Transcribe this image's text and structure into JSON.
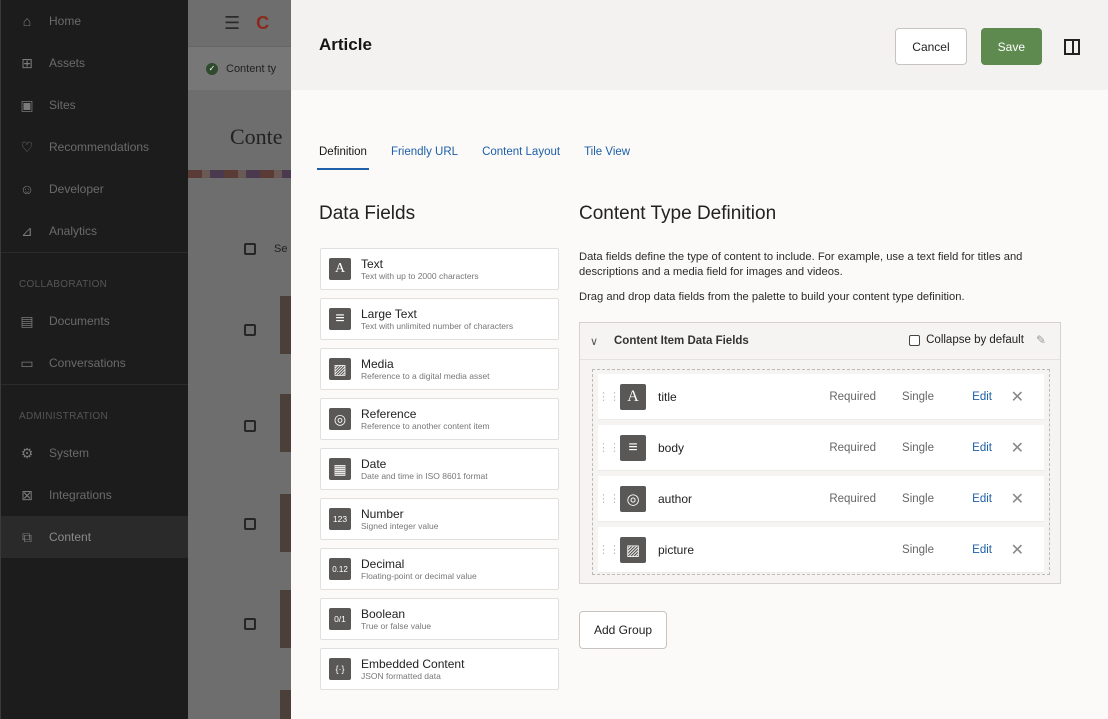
{
  "nav": {
    "items_top": [
      {
        "label": "Home",
        "icon": "home-icon"
      },
      {
        "label": "Assets",
        "icon": "assets-icon"
      },
      {
        "label": "Sites",
        "icon": "sites-icon"
      },
      {
        "label": "Recommendations",
        "icon": "recommendations-icon"
      },
      {
        "label": "Developer",
        "icon": "developer-icon"
      },
      {
        "label": "Analytics",
        "icon": "analytics-icon"
      }
    ],
    "section_collab": "COLLABORATION",
    "items_collab": [
      {
        "label": "Documents",
        "icon": "documents-icon"
      },
      {
        "label": "Conversations",
        "icon": "conversations-icon"
      }
    ],
    "section_admin": "ADMINISTRATION",
    "items_admin": [
      {
        "label": "System",
        "icon": "system-icon"
      },
      {
        "label": "Integrations",
        "icon": "integrations-icon"
      },
      {
        "label": "Content",
        "icon": "content-icon"
      }
    ]
  },
  "background": {
    "status_text": "Content ty",
    "title": "Conte",
    "select_label": "Se"
  },
  "panel": {
    "title": "Article",
    "cancel_label": "Cancel",
    "save_label": "Save",
    "colors": {
      "accent": "#1d5fa8",
      "save": "#5e8a4f"
    }
  },
  "tabs": [
    "Definition",
    "Friendly URL",
    "Content Layout",
    "Tile View"
  ],
  "data_fields": {
    "title": "Data Fields",
    "items": [
      {
        "name": "Text",
        "desc": "Text with up to 2000 characters",
        "icon": "A"
      },
      {
        "name": "Large Text",
        "desc": "Text with unlimited number of characters",
        "icon": "≡"
      },
      {
        "name": "Media",
        "desc": "Reference to a digital media asset",
        "icon": "▨"
      },
      {
        "name": "Reference",
        "desc": "Reference to another content item",
        "icon": "◎"
      },
      {
        "name": "Date",
        "desc": "Date and time in ISO 8601 format",
        "icon": "▦"
      },
      {
        "name": "Number",
        "desc": "Signed integer value",
        "icon": "123"
      },
      {
        "name": "Decimal",
        "desc": "Floating-point or decimal value",
        "icon": "0.12"
      },
      {
        "name": "Boolean",
        "desc": "True or false value",
        "icon": "0/1"
      },
      {
        "name": "Embedded Content",
        "desc": "JSON formatted data",
        "icon": "{·}"
      }
    ]
  },
  "definition": {
    "title": "Content Type Definition",
    "desc1": "Data fields define the type of content to include. For example, use a text field for titles and descriptions and a media field for images and videos.",
    "desc2": "Drag and drop data fields from the palette to build your content type definition.",
    "group_title": "Content Item Data Fields",
    "collapse_label": "Collapse by default",
    "fields": [
      {
        "name": "title",
        "required": "Required",
        "cardinality": "Single",
        "edit": "Edit",
        "icon": "A"
      },
      {
        "name": "body",
        "required": "Required",
        "cardinality": "Single",
        "edit": "Edit",
        "icon": "≡"
      },
      {
        "name": "author",
        "required": "Required",
        "cardinality": "Single",
        "edit": "Edit",
        "icon": "◎"
      },
      {
        "name": "picture",
        "required": "",
        "cardinality": "Single",
        "edit": "Edit",
        "icon": "▨"
      }
    ],
    "add_group_label": "Add Group"
  }
}
